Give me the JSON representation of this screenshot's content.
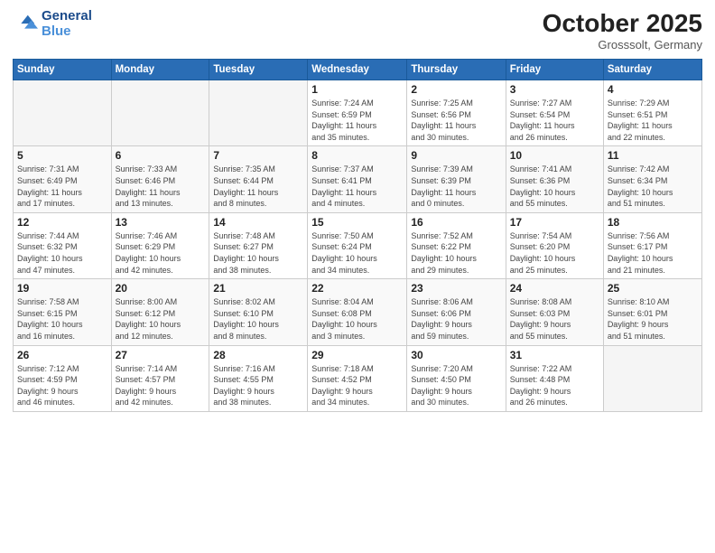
{
  "header": {
    "logo_line1": "General",
    "logo_line2": "Blue",
    "month": "October 2025",
    "location": "Grosssolt, Germany"
  },
  "days_of_week": [
    "Sunday",
    "Monday",
    "Tuesday",
    "Wednesday",
    "Thursday",
    "Friday",
    "Saturday"
  ],
  "weeks": [
    [
      {
        "day": "",
        "info": ""
      },
      {
        "day": "",
        "info": ""
      },
      {
        "day": "",
        "info": ""
      },
      {
        "day": "1",
        "info": "Sunrise: 7:24 AM\nSunset: 6:59 PM\nDaylight: 11 hours\nand 35 minutes."
      },
      {
        "day": "2",
        "info": "Sunrise: 7:25 AM\nSunset: 6:56 PM\nDaylight: 11 hours\nand 30 minutes."
      },
      {
        "day": "3",
        "info": "Sunrise: 7:27 AM\nSunset: 6:54 PM\nDaylight: 11 hours\nand 26 minutes."
      },
      {
        "day": "4",
        "info": "Sunrise: 7:29 AM\nSunset: 6:51 PM\nDaylight: 11 hours\nand 22 minutes."
      }
    ],
    [
      {
        "day": "5",
        "info": "Sunrise: 7:31 AM\nSunset: 6:49 PM\nDaylight: 11 hours\nand 17 minutes."
      },
      {
        "day": "6",
        "info": "Sunrise: 7:33 AM\nSunset: 6:46 PM\nDaylight: 11 hours\nand 13 minutes."
      },
      {
        "day": "7",
        "info": "Sunrise: 7:35 AM\nSunset: 6:44 PM\nDaylight: 11 hours\nand 8 minutes."
      },
      {
        "day": "8",
        "info": "Sunrise: 7:37 AM\nSunset: 6:41 PM\nDaylight: 11 hours\nand 4 minutes."
      },
      {
        "day": "9",
        "info": "Sunrise: 7:39 AM\nSunset: 6:39 PM\nDaylight: 11 hours\nand 0 minutes."
      },
      {
        "day": "10",
        "info": "Sunrise: 7:41 AM\nSunset: 6:36 PM\nDaylight: 10 hours\nand 55 minutes."
      },
      {
        "day": "11",
        "info": "Sunrise: 7:42 AM\nSunset: 6:34 PM\nDaylight: 10 hours\nand 51 minutes."
      }
    ],
    [
      {
        "day": "12",
        "info": "Sunrise: 7:44 AM\nSunset: 6:32 PM\nDaylight: 10 hours\nand 47 minutes."
      },
      {
        "day": "13",
        "info": "Sunrise: 7:46 AM\nSunset: 6:29 PM\nDaylight: 10 hours\nand 42 minutes."
      },
      {
        "day": "14",
        "info": "Sunrise: 7:48 AM\nSunset: 6:27 PM\nDaylight: 10 hours\nand 38 minutes."
      },
      {
        "day": "15",
        "info": "Sunrise: 7:50 AM\nSunset: 6:24 PM\nDaylight: 10 hours\nand 34 minutes."
      },
      {
        "day": "16",
        "info": "Sunrise: 7:52 AM\nSunset: 6:22 PM\nDaylight: 10 hours\nand 29 minutes."
      },
      {
        "day": "17",
        "info": "Sunrise: 7:54 AM\nSunset: 6:20 PM\nDaylight: 10 hours\nand 25 minutes."
      },
      {
        "day": "18",
        "info": "Sunrise: 7:56 AM\nSunset: 6:17 PM\nDaylight: 10 hours\nand 21 minutes."
      }
    ],
    [
      {
        "day": "19",
        "info": "Sunrise: 7:58 AM\nSunset: 6:15 PM\nDaylight: 10 hours\nand 16 minutes."
      },
      {
        "day": "20",
        "info": "Sunrise: 8:00 AM\nSunset: 6:12 PM\nDaylight: 10 hours\nand 12 minutes."
      },
      {
        "day": "21",
        "info": "Sunrise: 8:02 AM\nSunset: 6:10 PM\nDaylight: 10 hours\nand 8 minutes."
      },
      {
        "day": "22",
        "info": "Sunrise: 8:04 AM\nSunset: 6:08 PM\nDaylight: 10 hours\nand 3 minutes."
      },
      {
        "day": "23",
        "info": "Sunrise: 8:06 AM\nSunset: 6:06 PM\nDaylight: 9 hours\nand 59 minutes."
      },
      {
        "day": "24",
        "info": "Sunrise: 8:08 AM\nSunset: 6:03 PM\nDaylight: 9 hours\nand 55 minutes."
      },
      {
        "day": "25",
        "info": "Sunrise: 8:10 AM\nSunset: 6:01 PM\nDaylight: 9 hours\nand 51 minutes."
      }
    ],
    [
      {
        "day": "26",
        "info": "Sunrise: 7:12 AM\nSunset: 4:59 PM\nDaylight: 9 hours\nand 46 minutes."
      },
      {
        "day": "27",
        "info": "Sunrise: 7:14 AM\nSunset: 4:57 PM\nDaylight: 9 hours\nand 42 minutes."
      },
      {
        "day": "28",
        "info": "Sunrise: 7:16 AM\nSunset: 4:55 PM\nDaylight: 9 hours\nand 38 minutes."
      },
      {
        "day": "29",
        "info": "Sunrise: 7:18 AM\nSunset: 4:52 PM\nDaylight: 9 hours\nand 34 minutes."
      },
      {
        "day": "30",
        "info": "Sunrise: 7:20 AM\nSunset: 4:50 PM\nDaylight: 9 hours\nand 30 minutes."
      },
      {
        "day": "31",
        "info": "Sunrise: 7:22 AM\nSunset: 4:48 PM\nDaylight: 9 hours\nand 26 minutes."
      },
      {
        "day": "",
        "info": ""
      }
    ]
  ]
}
